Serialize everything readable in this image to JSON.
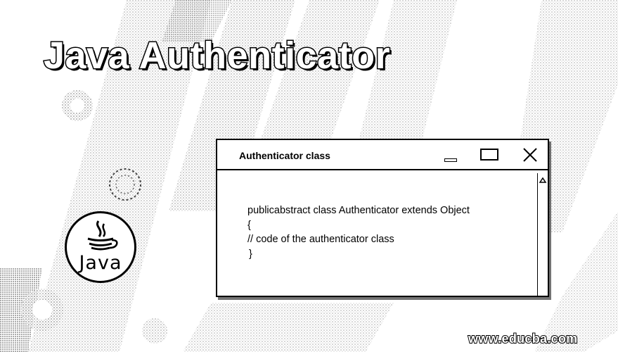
{
  "page": {
    "title": "Java Authenticator"
  },
  "logo": {
    "label": "Java",
    "icon": "java-coffee-cup-icon"
  },
  "window": {
    "title": "Authenticator class",
    "controls": {
      "minimize": "minimize-icon",
      "maximize": "maximize-icon",
      "close": "close-icon"
    },
    "code_lines": [
      "publicabstract class Authenticator extends Object",
      "{",
      "// code of the authenticator class",
      "}"
    ]
  },
  "footer": {
    "website": "www.educba.com"
  },
  "colors": {
    "foreground": "#000000",
    "background": "#ffffff"
  }
}
